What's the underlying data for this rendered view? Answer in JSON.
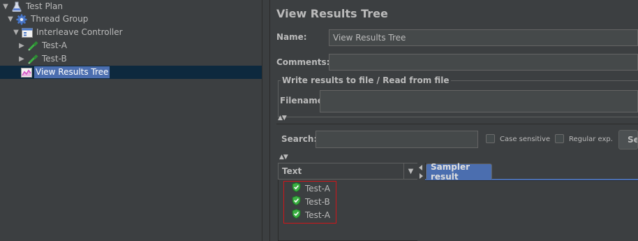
{
  "tree": {
    "items": [
      {
        "label": "Test Plan",
        "icon": "flask-icon",
        "expanded": true
      },
      {
        "label": "Thread Group",
        "icon": "gear-icon",
        "expanded": true
      },
      {
        "label": "Interleave Controller",
        "icon": "controller-icon",
        "expanded": true
      },
      {
        "label": "Test-A",
        "icon": "dropper-icon",
        "expanded": false
      },
      {
        "label": "Test-B",
        "icon": "dropper-icon",
        "expanded": false
      },
      {
        "label": "View Results Tree",
        "icon": "graph-icon",
        "selected": true
      }
    ]
  },
  "panel": {
    "title": "View Results Tree",
    "name_label": "Name:",
    "name_value": "View Results Tree",
    "comments_label": "Comments:",
    "comments_value": "",
    "file_group_legend": "Write results to file / Read from file",
    "filename_label": "Filename",
    "filename_value": ""
  },
  "search": {
    "label": "Search:",
    "value": "",
    "case_sensitive_label": "Case sensitive",
    "regex_label": "Regular exp.",
    "button_label": "Se"
  },
  "results": {
    "renderer_label": "Text",
    "items": [
      "Test-A",
      "Test-B",
      "Test-A"
    ],
    "status_icon": "shield-check-icon",
    "tab_label": "Sampler result"
  },
  "colors": {
    "background": "#3c3f41",
    "selection": "#4b6eaf",
    "success": "#3cb043",
    "highlight_border": "#d0161a"
  }
}
